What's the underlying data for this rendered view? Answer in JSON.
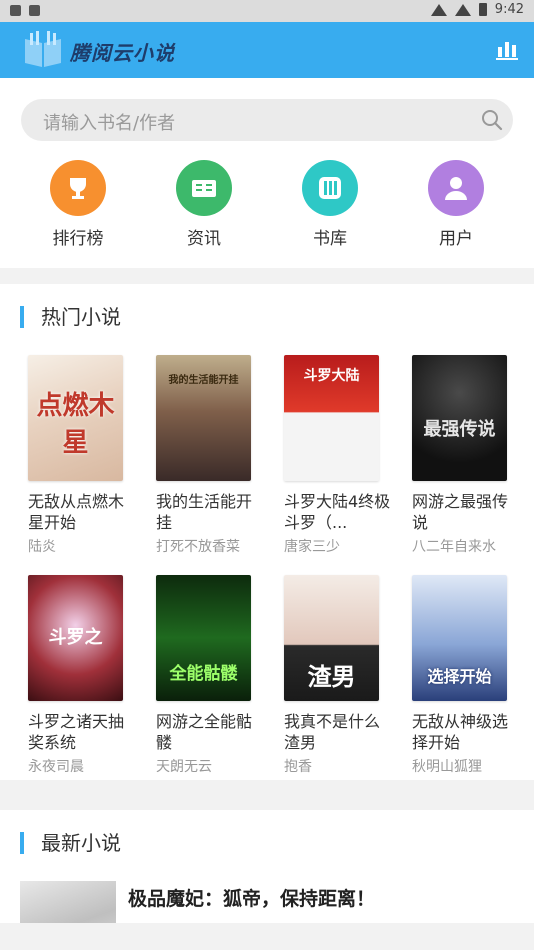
{
  "status_bar": {
    "time": "9:42"
  },
  "app": {
    "title": "腾阅云小说"
  },
  "search": {
    "placeholder": "请输入书名/作者"
  },
  "nav": [
    {
      "label": "排行榜",
      "icon": "trophy-icon",
      "color": "#f7902f"
    },
    {
      "label": "资讯",
      "icon": "news-icon",
      "color": "#3db96b"
    },
    {
      "label": "书库",
      "icon": "library-icon",
      "color": "#2ec8c6"
    },
    {
      "label": "用户",
      "icon": "user-icon",
      "color": "#b17fe0"
    }
  ],
  "hot": {
    "title": "热门小说",
    "books": [
      {
        "title": "无敌从点燃木星开始",
        "author": "陆炎",
        "cover_text": "点燃木星"
      },
      {
        "title": "我的生活能开挂",
        "author": "打死不放香菜",
        "cover_text": "我的生活能开挂"
      },
      {
        "title": "斗罗大陆4终极斗罗（...",
        "author": "唐家三少",
        "cover_text": "斗罗大陆"
      },
      {
        "title": "网游之最强传说",
        "author": "八二年自来水",
        "cover_text": "最强传说"
      },
      {
        "title": "斗罗之诸天抽奖系统",
        "author": "永夜司晨",
        "cover_text": "斗罗之"
      },
      {
        "title": "网游之全能骷髅",
        "author": "天朗无云",
        "cover_text": "全能骷髅"
      },
      {
        "title": "我真不是什么渣男",
        "author": "抱香",
        "cover_text": "渣男"
      },
      {
        "title": "无敌从神级选择开始",
        "author": "秋明山狐狸",
        "cover_text": "选择开始"
      }
    ]
  },
  "latest": {
    "title": "最新小说",
    "first_book_title": "极品魔妃：狐帝，保持距离！"
  }
}
